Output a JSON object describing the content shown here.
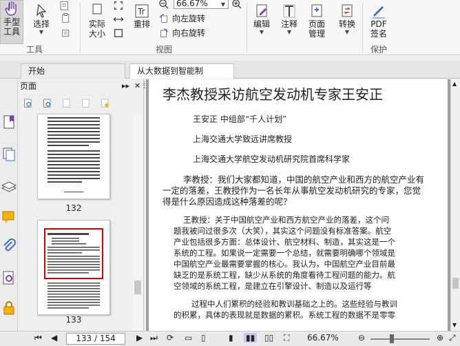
{
  "ribbon": {
    "hand_tool": {
      "line1": "手型",
      "line2": "工具"
    },
    "select": "选择",
    "actual_size": {
      "line1": "实际",
      "line2": "大小"
    },
    "reflow": "重排",
    "zoom_value": "66.67%",
    "rotate_left": "向左旋转",
    "rotate_right": "向右旋转",
    "edit": "编辑",
    "annotate": "注释",
    "page_manage": {
      "line1": "页面",
      "line2": "管理"
    },
    "convert": "转换",
    "pdf_sign": {
      "line1": "PDF",
      "line2": "签名"
    },
    "group_tools": "工具",
    "group_view": "视图",
    "group_protect": "保护"
  },
  "tabs": [
    {
      "label": "开始"
    },
    {
      "label": "从大数据到智能制造.pdf"
    }
  ],
  "panel": {
    "title": "页面",
    "thumbs": [
      {
        "label": "132"
      },
      {
        "label": "133"
      }
    ]
  },
  "document": {
    "title": "李杰教授采访航空发动机专家王安正",
    "meta": [
      "王安正  中组部“千人计划”",
      "上海交通大学致远讲席教授",
      "上海交通大学航空发动机研究院首席科学家"
    ],
    "q_lines": [
      "李教授：我们大家都知道，中国的航空产业和西方的航空产业有",
      "一定的落差，王教授作为一名长年从事航空发动机研究的专家，您觉",
      "得是什么原因造成这种落差的呢？"
    ],
    "a_lines": [
      "王教授：关于中国航空产业和西方航空产业的落差，这个问",
      "题我被问过很多次（大笑），其实这个问题没有标准答案。航空",
      "产业包括很多方面：总体设计、航空材料、制造，其实这是一个",
      "系统的工程。如果说一定需要一个总结，就需要明确哪个领域是",
      "中国航空产业最需要掌握的核心。我认为，中国航空产业目前最",
      "缺乏的是系统工程，缺少从系统的角度看待工程问题的能力。航",
      "空领域的系统工程，是建立在引擎设计、制造以及运行等"
    ],
    "p_lines": [
      "过程中人们累积的经验和教训基础之上的。这些经验与教训",
      "的积累，具体的表现就是数据的累积。系统工程的数据不是零零"
    ]
  },
  "status": {
    "page_indicator": "133 / 154",
    "zoom": "66.67%"
  }
}
